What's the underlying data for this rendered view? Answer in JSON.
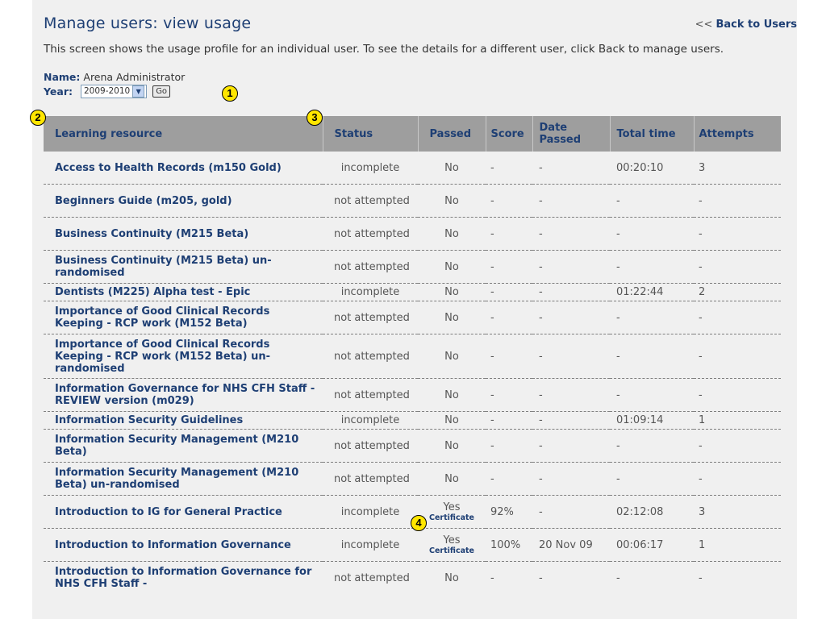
{
  "header": {
    "title": "Manage users: view usage",
    "back_prefix": "<<",
    "back_label": "Back to Users"
  },
  "intro_text": "This screen shows the usage profile for an individual user. To see the details for a different user, click Back to manage users.",
  "user": {
    "name_label": "Name:",
    "name_value": "Arena Administrator",
    "year_label": "Year:",
    "year_value": "2009-2010",
    "go_label": "Go"
  },
  "callouts": [
    "1",
    "2",
    "3",
    "4"
  ],
  "table": {
    "columns": [
      "Learning resource",
      "Status",
      "Passed",
      "Score",
      "Date Passed",
      "Total time",
      "Attempts"
    ],
    "rows": [
      {
        "resource": "Access to Health Records (m150 Gold)",
        "status": "incomplete",
        "passed": "No",
        "certificate": "",
        "score": "-",
        "date": "-",
        "time": "00:20:10",
        "attempts": "3"
      },
      {
        "resource": "Beginners Guide (m205, gold)",
        "status": "not attempted",
        "passed": "No",
        "certificate": "",
        "score": "-",
        "date": "-",
        "time": "-",
        "attempts": "-"
      },
      {
        "resource": "Business Continuity (M215 Beta)",
        "status": "not attempted",
        "passed": "No",
        "certificate": "",
        "score": "-",
        "date": "-",
        "time": "-",
        "attempts": "-"
      },
      {
        "resource": "Business Continuity (M215 Beta) un-randomised",
        "status": "not attempted",
        "passed": "No",
        "certificate": "",
        "score": "-",
        "date": "-",
        "time": "-",
        "attempts": "-"
      },
      {
        "resource": "Dentists (M225) Alpha test - Epic",
        "status": "incomplete",
        "passed": "No",
        "certificate": "",
        "score": "-",
        "date": "-",
        "time": "01:22:44",
        "attempts": "2"
      },
      {
        "resource": "Importance of Good Clinical Records Keeping - RCP work (M152 Beta)",
        "status": "not attempted",
        "passed": "No",
        "certificate": "",
        "score": "-",
        "date": "-",
        "time": "-",
        "attempts": "-"
      },
      {
        "resource": "Importance of Good Clinical Records Keeping - RCP work (M152 Beta) un-randomised",
        "status": "not attempted",
        "passed": "No",
        "certificate": "",
        "score": "-",
        "date": "-",
        "time": "-",
        "attempts": "-"
      },
      {
        "resource": "Information Governance for NHS CFH Staff - REVIEW version (m029)",
        "status": "not attempted",
        "passed": "No",
        "certificate": "",
        "score": "-",
        "date": "-",
        "time": "-",
        "attempts": "-"
      },
      {
        "resource": "Information Security Guidelines",
        "status": "incomplete",
        "passed": "No",
        "certificate": "",
        "score": "-",
        "date": "-",
        "time": "01:09:14",
        "attempts": "1"
      },
      {
        "resource": "Information Security Management (M210 Beta)",
        "status": "not attempted",
        "passed": "No",
        "certificate": "",
        "score": "-",
        "date": "-",
        "time": "-",
        "attempts": "-"
      },
      {
        "resource": "Information Security Management (M210 Beta) un-randomised",
        "status": "not attempted",
        "passed": "No",
        "certificate": "",
        "score": "-",
        "date": "-",
        "time": "-",
        "attempts": "-"
      },
      {
        "resource": "Introduction to IG for General Practice",
        "status": "incomplete",
        "passed": "Yes",
        "certificate": "Certificate",
        "score": "92%",
        "date": "-",
        "time": "02:12:08",
        "attempts": "3"
      },
      {
        "resource": "Introduction to Information Governance",
        "status": "incomplete",
        "passed": "Yes",
        "certificate": "Certificate",
        "score": "100%",
        "date": "20 Nov 09",
        "time": "00:06:17",
        "attempts": "1"
      },
      {
        "resource": "Introduction to Information Governance for NHS CFH Staff -",
        "status": "not attempted",
        "passed": "No",
        "certificate": "",
        "score": "-",
        "date": "-",
        "time": "-",
        "attempts": "-"
      }
    ]
  },
  "colors": {
    "accent": "#1e3f74",
    "header_bg": "#9e9e9e",
    "panel_bg": "#f0f0f0",
    "callout": "#ffe600"
  }
}
